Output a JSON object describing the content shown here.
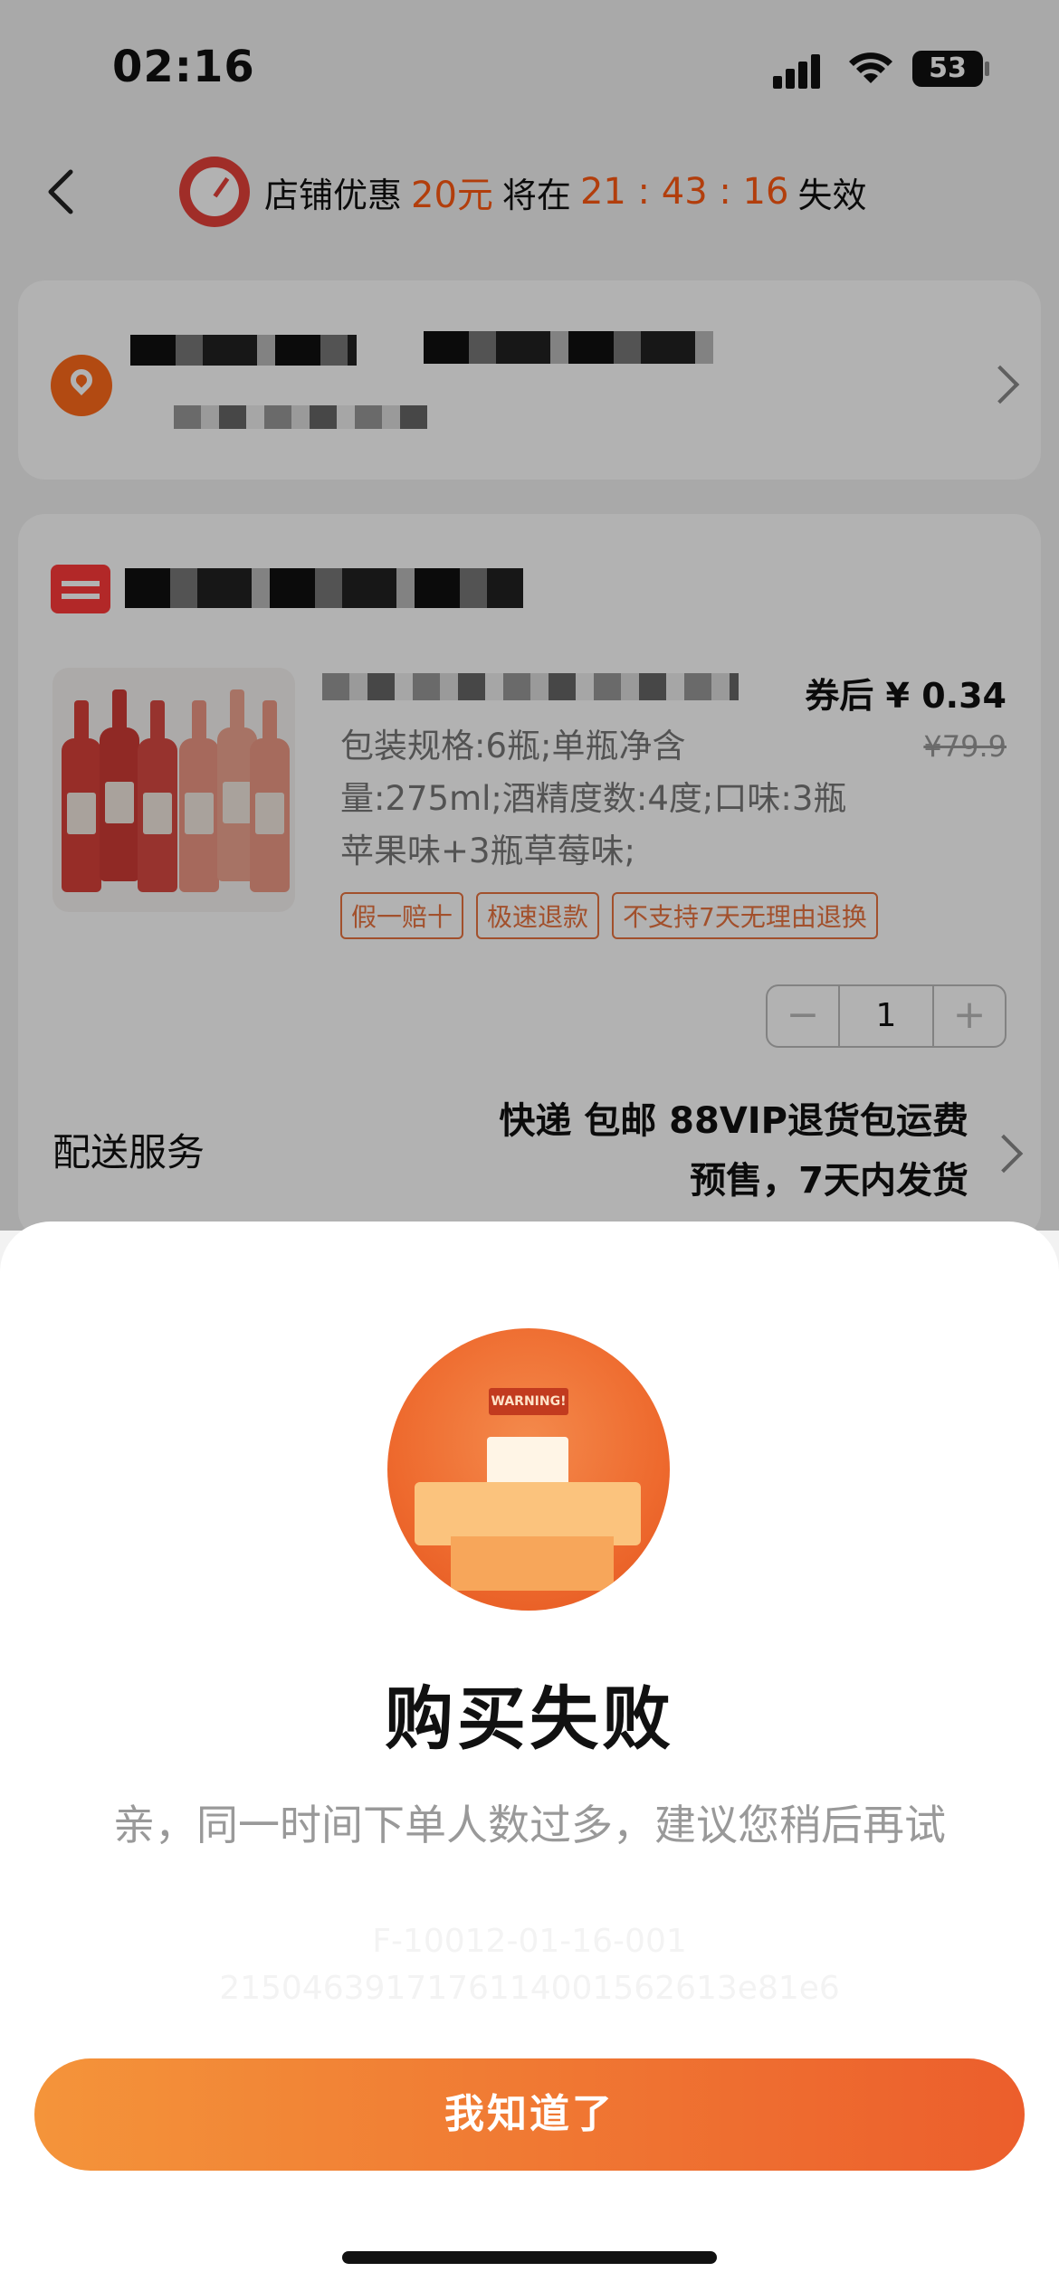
{
  "status_bar": {
    "time": "02:16",
    "battery": "53"
  },
  "header": {
    "promo_prefix": "店铺优惠",
    "promo_amount": "20元",
    "promo_middle": "将在",
    "countdown": "21 : 43 : 16",
    "promo_suffix": "失效"
  },
  "order": {
    "price_after_coupon": "券后 ¥ 0.34",
    "original_price": "¥79.9",
    "spec": "包装规格:6瓶;单瓶净含量:275ml;酒精度数:4度;口味:3瓶苹果味+3瓶草莓味;",
    "tags": [
      "假一赔十",
      "极速退款",
      "不支持7天无理由退换"
    ],
    "quantity": "1",
    "stepper_minus": "−",
    "stepper_plus": "+",
    "delivery_label": "配送服务",
    "delivery_line1": "快递 包邮 88VIP退货包运费",
    "delivery_line2": "预售，7天内发货"
  },
  "dialog": {
    "illustration_sign": "WARNING!",
    "title": "购买失败",
    "message": "亲，同一时间下单人数过多，建议您稍后再试",
    "error_code_line1": "F-10012-01-16-001",
    "error_code_line2": "2150463917176114001562613e81e6",
    "confirm_label": "我知道了"
  },
  "colors": {
    "accent": "#ff5a12",
    "button_start": "#f4943a",
    "button_end": "#ec5e2c"
  }
}
